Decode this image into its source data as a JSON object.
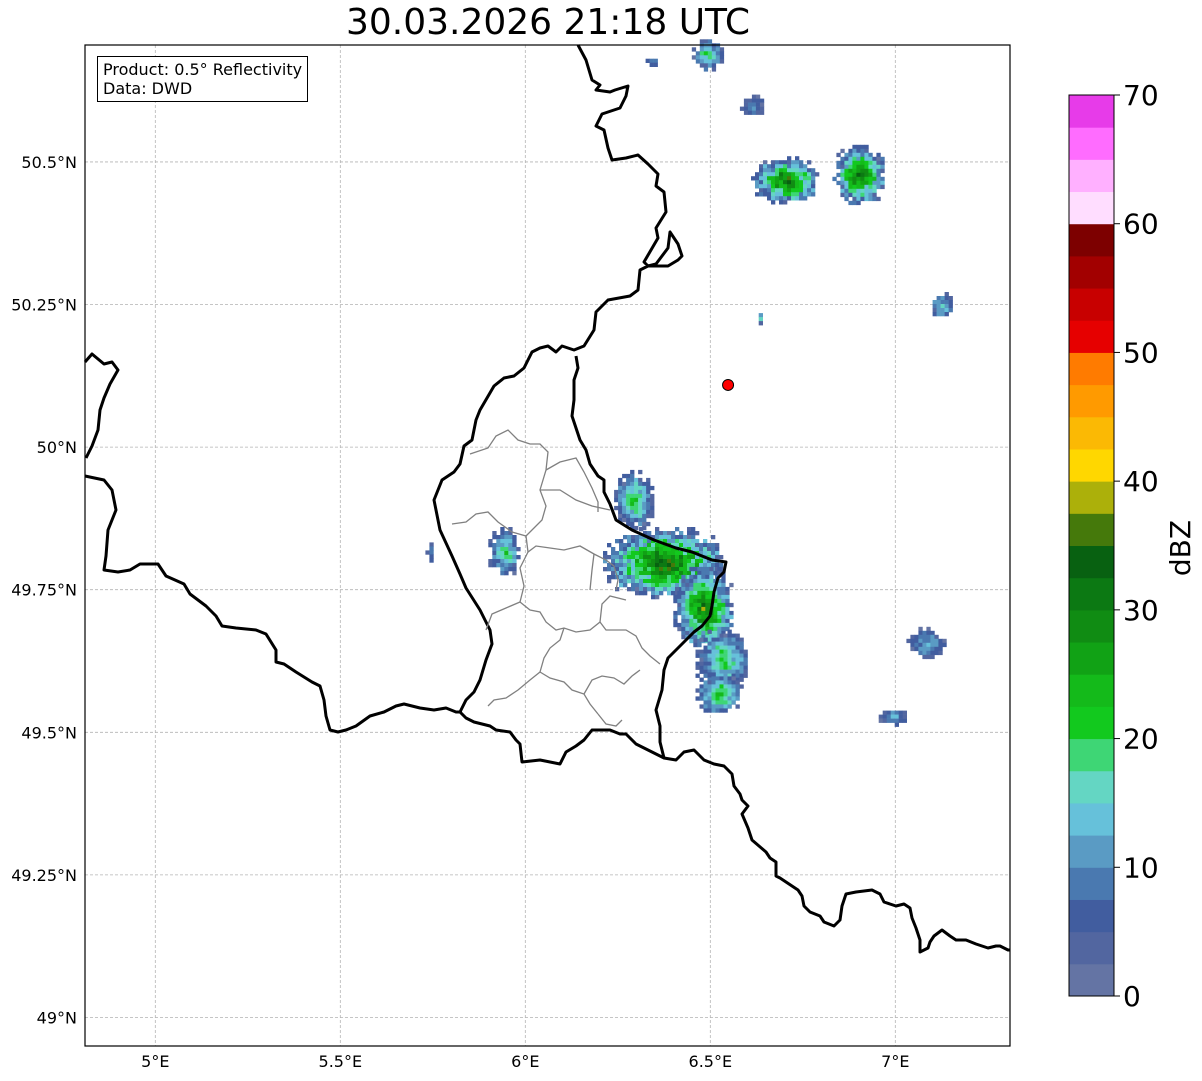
{
  "title": "30.03.2026 21:18 UTC",
  "info": {
    "product": "Product: 0.5° Reflectivity",
    "data": "Data: DWD"
  },
  "map": {
    "lon_range": [
      4.81,
      7.31
    ],
    "lat_range": [
      48.95,
      50.705
    ],
    "lat_ticks": [
      {
        "value": 50.5,
        "label": "50.5°N"
      },
      {
        "value": 50.25,
        "label": "50.25°N"
      },
      {
        "value": 50.0,
        "label": "50°N"
      },
      {
        "value": 49.75,
        "label": "49.75°N"
      },
      {
        "value": 49.5,
        "label": "49.5°N"
      },
      {
        "value": 49.25,
        "label": "49.25°N"
      },
      {
        "value": 49.0,
        "label": "49°N"
      }
    ],
    "lon_ticks": [
      {
        "value": 5.0,
        "label": "5°E"
      },
      {
        "value": 5.5,
        "label": "5.5°E"
      },
      {
        "value": 6.0,
        "label": "6°E"
      },
      {
        "value": 6.5,
        "label": "6.5°E"
      },
      {
        "value": 7.0,
        "label": "7°E"
      }
    ],
    "radar_site": {
      "lon": 6.548,
      "lat": 50.109,
      "color": "#ff0000"
    }
  },
  "colorbar": {
    "label": "dBZ",
    "range": [
      0,
      70
    ],
    "ticks": [
      "0",
      "10",
      "20",
      "30",
      "40",
      "50",
      "60",
      "70"
    ],
    "colors": [
      "#6474a4",
      "#5266a0",
      "#415d9f",
      "#4a79b0",
      "#5a9bc4",
      "#66c1da",
      "#64d6c3",
      "#3ed675",
      "#12c91e",
      "#14ba1a",
      "#11a215",
      "#108c13",
      "#0c7913",
      "#086111",
      "#45790b",
      "#acb00a",
      "#ffd700",
      "#fbb904",
      "#ff9a00",
      "#ff7b00",
      "#e60000",
      "#c80000",
      "#a20000",
      "#7d0000",
      "#ffddff",
      "#ffb0ff",
      "#ff6cff",
      "#e73be9"
    ]
  },
  "echoes": [
    {
      "lon": 6.49,
      "lat": 50.69,
      "rlon": 0.04,
      "rlat": 0.025,
      "peak": 22
    },
    {
      "lon": 6.34,
      "lat": 50.68,
      "rlon": 0.015,
      "rlat": 0.008,
      "peak": 12
    },
    {
      "lon": 6.61,
      "lat": 50.6,
      "rlon": 0.03,
      "rlat": 0.018,
      "peak": 12
    },
    {
      "lon": 6.7,
      "lat": 50.47,
      "rlon": 0.09,
      "rlat": 0.04,
      "peak": 34
    },
    {
      "lon": 6.9,
      "lat": 50.48,
      "rlon": 0.07,
      "rlat": 0.05,
      "peak": 33
    },
    {
      "lon": 7.12,
      "lat": 50.25,
      "rlon": 0.03,
      "rlat": 0.022,
      "peak": 18
    },
    {
      "lon": 6.63,
      "lat": 50.23,
      "rlon": 0.01,
      "rlat": 0.012,
      "peak": 15
    },
    {
      "lon": 5.94,
      "lat": 49.82,
      "rlon": 0.04,
      "rlat": 0.04,
      "peak": 22
    },
    {
      "lon": 5.74,
      "lat": 49.82,
      "rlon": 0.01,
      "rlat": 0.02,
      "peak": 10
    },
    {
      "lon": 6.29,
      "lat": 49.91,
      "rlon": 0.05,
      "rlat": 0.05,
      "peak": 25
    },
    {
      "lon": 6.37,
      "lat": 49.8,
      "rlon": 0.16,
      "rlat": 0.06,
      "peak": 36
    },
    {
      "lon": 6.48,
      "lat": 49.72,
      "rlon": 0.08,
      "rlat": 0.07,
      "peak": 34
    },
    {
      "lon": 6.53,
      "lat": 49.63,
      "rlon": 0.07,
      "rlat": 0.05,
      "peak": 22
    },
    {
      "lon": 6.52,
      "lat": 49.57,
      "rlon": 0.06,
      "rlat": 0.035,
      "peak": 24
    },
    {
      "lon": 7.08,
      "lat": 49.66,
      "rlon": 0.05,
      "rlat": 0.025,
      "peak": 15
    },
    {
      "lon": 6.99,
      "lat": 49.53,
      "rlon": 0.035,
      "rlat": 0.015,
      "peak": 14
    }
  ]
}
